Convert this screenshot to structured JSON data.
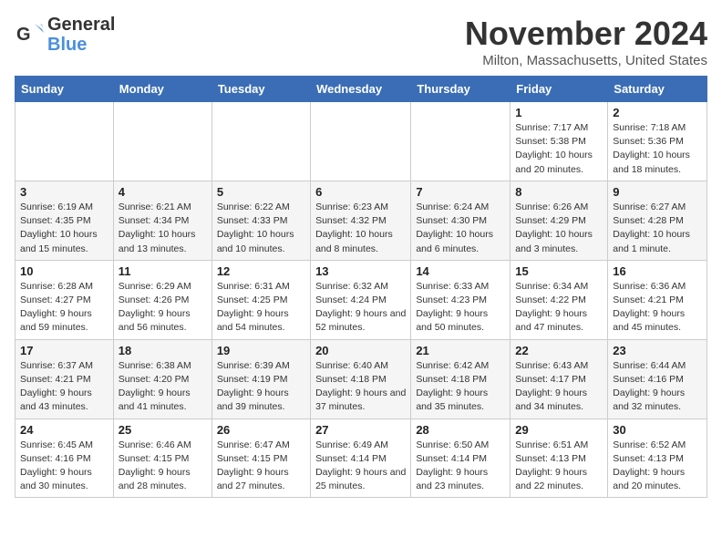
{
  "logo": {
    "line1": "General",
    "line2": "Blue"
  },
  "title": "November 2024",
  "location": "Milton, Massachusetts, United States",
  "days_header": [
    "Sunday",
    "Monday",
    "Tuesday",
    "Wednesday",
    "Thursday",
    "Friday",
    "Saturday"
  ],
  "weeks": [
    [
      {
        "day": "",
        "info": ""
      },
      {
        "day": "",
        "info": ""
      },
      {
        "day": "",
        "info": ""
      },
      {
        "day": "",
        "info": ""
      },
      {
        "day": "",
        "info": ""
      },
      {
        "day": "1",
        "info": "Sunrise: 7:17 AM\nSunset: 5:38 PM\nDaylight: 10 hours and 20 minutes."
      },
      {
        "day": "2",
        "info": "Sunrise: 7:18 AM\nSunset: 5:36 PM\nDaylight: 10 hours and 18 minutes."
      }
    ],
    [
      {
        "day": "3",
        "info": "Sunrise: 6:19 AM\nSunset: 4:35 PM\nDaylight: 10 hours and 15 minutes."
      },
      {
        "day": "4",
        "info": "Sunrise: 6:21 AM\nSunset: 4:34 PM\nDaylight: 10 hours and 13 minutes."
      },
      {
        "day": "5",
        "info": "Sunrise: 6:22 AM\nSunset: 4:33 PM\nDaylight: 10 hours and 10 minutes."
      },
      {
        "day": "6",
        "info": "Sunrise: 6:23 AM\nSunset: 4:32 PM\nDaylight: 10 hours and 8 minutes."
      },
      {
        "day": "7",
        "info": "Sunrise: 6:24 AM\nSunset: 4:30 PM\nDaylight: 10 hours and 6 minutes."
      },
      {
        "day": "8",
        "info": "Sunrise: 6:26 AM\nSunset: 4:29 PM\nDaylight: 10 hours and 3 minutes."
      },
      {
        "day": "9",
        "info": "Sunrise: 6:27 AM\nSunset: 4:28 PM\nDaylight: 10 hours and 1 minute."
      }
    ],
    [
      {
        "day": "10",
        "info": "Sunrise: 6:28 AM\nSunset: 4:27 PM\nDaylight: 9 hours and 59 minutes."
      },
      {
        "day": "11",
        "info": "Sunrise: 6:29 AM\nSunset: 4:26 PM\nDaylight: 9 hours and 56 minutes."
      },
      {
        "day": "12",
        "info": "Sunrise: 6:31 AM\nSunset: 4:25 PM\nDaylight: 9 hours and 54 minutes."
      },
      {
        "day": "13",
        "info": "Sunrise: 6:32 AM\nSunset: 4:24 PM\nDaylight: 9 hours and 52 minutes."
      },
      {
        "day": "14",
        "info": "Sunrise: 6:33 AM\nSunset: 4:23 PM\nDaylight: 9 hours and 50 minutes."
      },
      {
        "day": "15",
        "info": "Sunrise: 6:34 AM\nSunset: 4:22 PM\nDaylight: 9 hours and 47 minutes."
      },
      {
        "day": "16",
        "info": "Sunrise: 6:36 AM\nSunset: 4:21 PM\nDaylight: 9 hours and 45 minutes."
      }
    ],
    [
      {
        "day": "17",
        "info": "Sunrise: 6:37 AM\nSunset: 4:21 PM\nDaylight: 9 hours and 43 minutes."
      },
      {
        "day": "18",
        "info": "Sunrise: 6:38 AM\nSunset: 4:20 PM\nDaylight: 9 hours and 41 minutes."
      },
      {
        "day": "19",
        "info": "Sunrise: 6:39 AM\nSunset: 4:19 PM\nDaylight: 9 hours and 39 minutes."
      },
      {
        "day": "20",
        "info": "Sunrise: 6:40 AM\nSunset: 4:18 PM\nDaylight: 9 hours and 37 minutes."
      },
      {
        "day": "21",
        "info": "Sunrise: 6:42 AM\nSunset: 4:18 PM\nDaylight: 9 hours and 35 minutes."
      },
      {
        "day": "22",
        "info": "Sunrise: 6:43 AM\nSunset: 4:17 PM\nDaylight: 9 hours and 34 minutes."
      },
      {
        "day": "23",
        "info": "Sunrise: 6:44 AM\nSunset: 4:16 PM\nDaylight: 9 hours and 32 minutes."
      }
    ],
    [
      {
        "day": "24",
        "info": "Sunrise: 6:45 AM\nSunset: 4:16 PM\nDaylight: 9 hours and 30 minutes."
      },
      {
        "day": "25",
        "info": "Sunrise: 6:46 AM\nSunset: 4:15 PM\nDaylight: 9 hours and 28 minutes."
      },
      {
        "day": "26",
        "info": "Sunrise: 6:47 AM\nSunset: 4:15 PM\nDaylight: 9 hours and 27 minutes."
      },
      {
        "day": "27",
        "info": "Sunrise: 6:49 AM\nSunset: 4:14 PM\nDaylight: 9 hours and 25 minutes."
      },
      {
        "day": "28",
        "info": "Sunrise: 6:50 AM\nSunset: 4:14 PM\nDaylight: 9 hours and 23 minutes."
      },
      {
        "day": "29",
        "info": "Sunrise: 6:51 AM\nSunset: 4:13 PM\nDaylight: 9 hours and 22 minutes."
      },
      {
        "day": "30",
        "info": "Sunrise: 6:52 AM\nSunset: 4:13 PM\nDaylight: 9 hours and 20 minutes."
      }
    ]
  ]
}
